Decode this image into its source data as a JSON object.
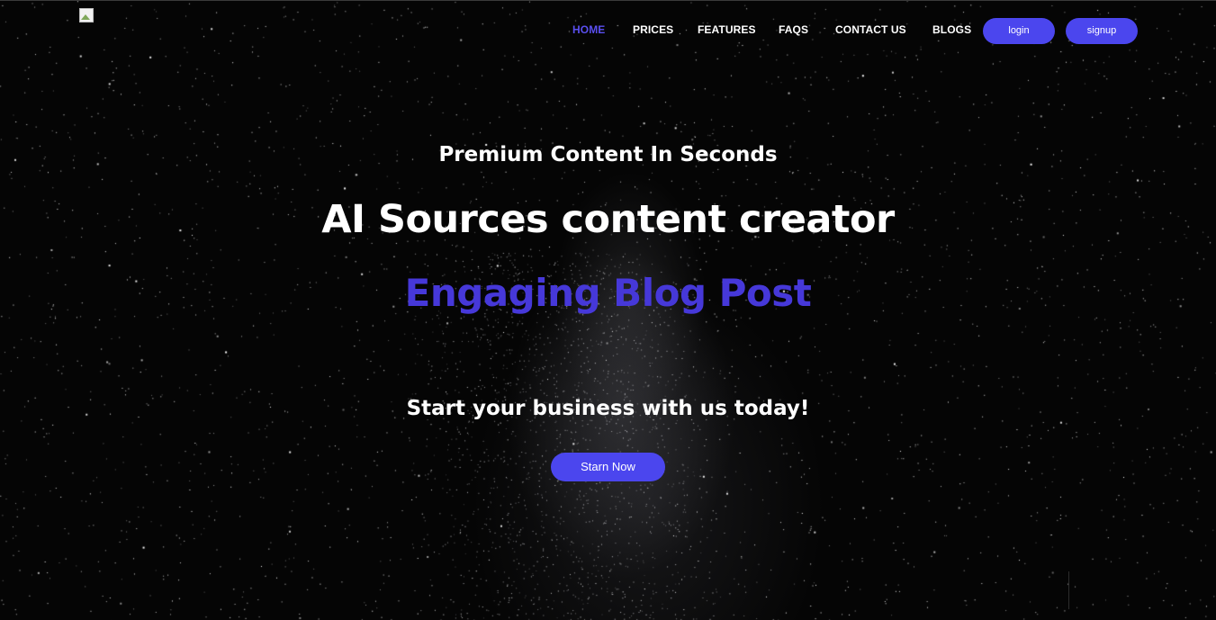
{
  "nav": {
    "links": [
      {
        "label": "HOME",
        "active": true
      },
      {
        "label": "PRICES",
        "active": false
      },
      {
        "label": "FEATURES",
        "active": false
      },
      {
        "label": "FAQS",
        "active": false
      },
      {
        "label": "CONTACT US",
        "active": false
      },
      {
        "label": "BLOGS",
        "active": false
      }
    ],
    "login_label": "login",
    "signup_label": "signup"
  },
  "hero": {
    "tagline": "Premium Content In Seconds",
    "headline": "AI Sources content creator",
    "rotating_text": "Engaging Blog Post",
    "cta_text": "Start your business with us today!",
    "cta_button": "Starn Now"
  },
  "colors": {
    "accent": "#4b46ee",
    "rotating_text": "#4638d9",
    "active_link": "#5a4ff0",
    "background": "#050505"
  },
  "icons": {
    "logo": "broken-image-icon"
  }
}
